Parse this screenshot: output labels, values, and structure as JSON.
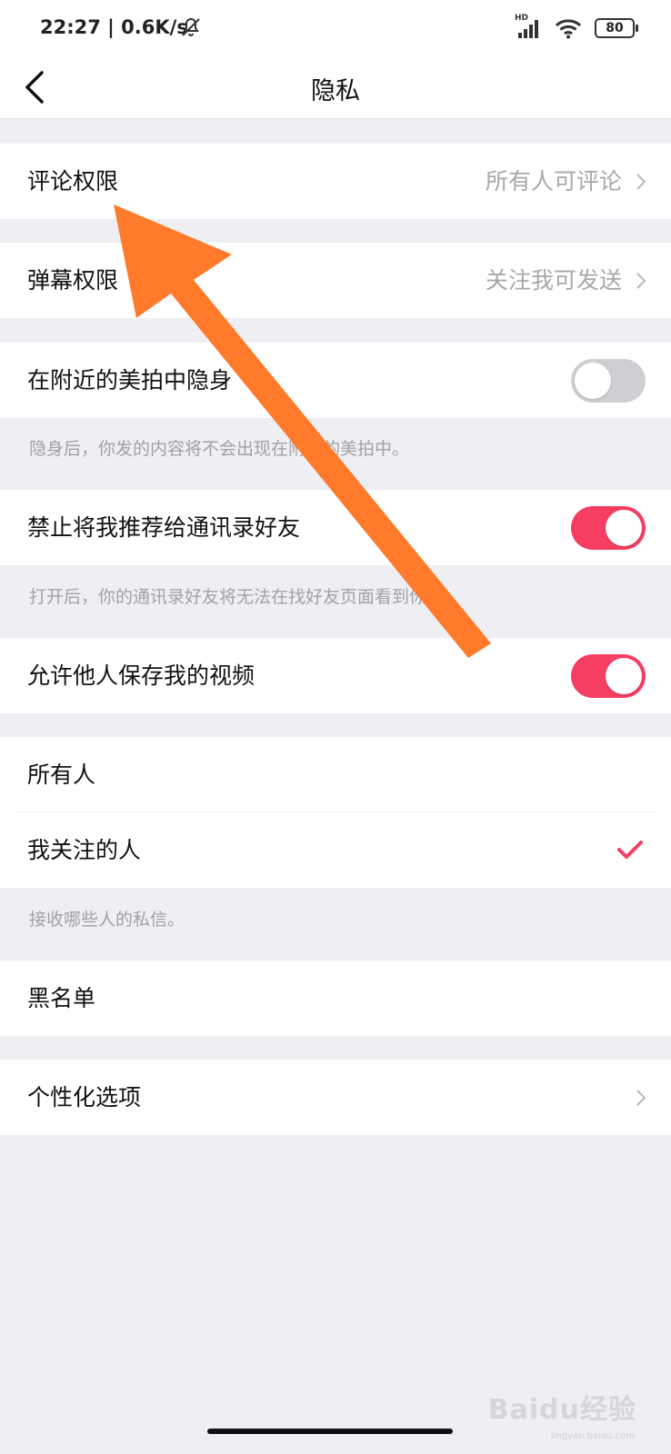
{
  "status_bar": {
    "time": "22:27 | 0.6K/s",
    "network_label": "HD",
    "battery": "80",
    "icons": [
      "mute-bell-icon",
      "signal-icon",
      "wifi-icon",
      "battery-icon"
    ]
  },
  "header": {
    "title": "隐私",
    "back_icon": "chevron-left-icon"
  },
  "settings": {
    "comment_permission": {
      "label": "评论权限",
      "value": "所有人可评论"
    },
    "danmaku_permission": {
      "label": "弹幕权限",
      "value": "关注我可发送"
    },
    "hide_nearby": {
      "label": "在附近的美拍中隐身",
      "enabled": false,
      "hint": "隐身后，你发的内容将不会出现在附近的美拍中。"
    },
    "block_contacts_recommend": {
      "label": "禁止将我推荐给通讯录好友",
      "enabled": true,
      "hint": "打开后，你的通讯录好友将无法在找好友页面看到你。"
    },
    "allow_save_videos": {
      "label": "允许他人保存我的视频",
      "enabled": true
    },
    "private_message": {
      "options": [
        {
          "label": "所有人",
          "selected": false
        },
        {
          "label": "我关注的人",
          "selected": true
        }
      ],
      "hint": "接收哪些人的私信。"
    },
    "blacklist": {
      "label": "黑名单"
    },
    "personalization": {
      "label": "个性化选项"
    }
  },
  "colors": {
    "accent": "#f53e62",
    "annotation_arrow": "#ff7a2b",
    "background": "#efeff3"
  },
  "watermark": {
    "brand": "Baidu经验",
    "url": "jingyan.baidu.com"
  }
}
